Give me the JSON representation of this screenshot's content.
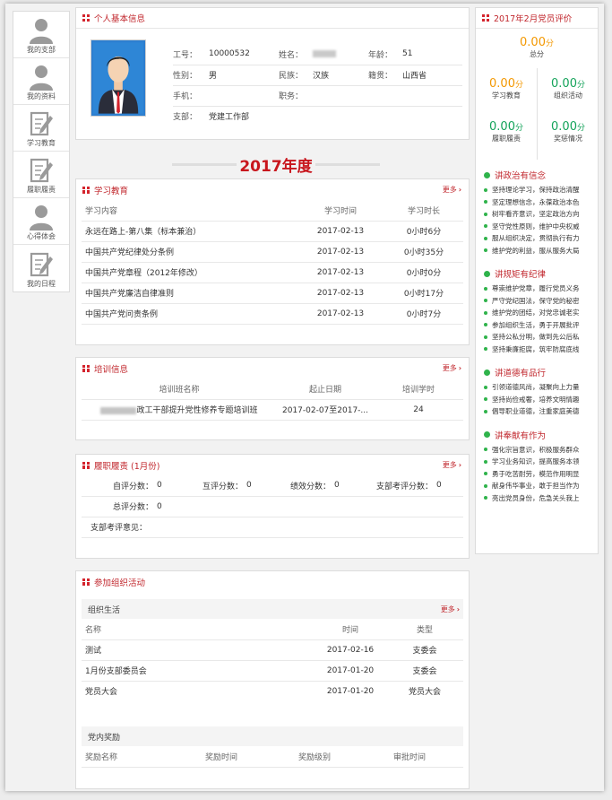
{
  "sidebar": {
    "items": [
      {
        "label": "我的支部",
        "icon": "user-icon"
      },
      {
        "label": "我的资料",
        "icon": "user-icon"
      },
      {
        "label": "学习教育",
        "icon": "pencil-doc-icon"
      },
      {
        "label": "履职履责",
        "icon": "pencil-doc-icon"
      },
      {
        "label": "心得体会",
        "icon": "user-icon"
      },
      {
        "label": "我的日程",
        "icon": "pencil-doc-icon"
      }
    ]
  },
  "profile": {
    "title": "个人基本信息",
    "id_label": "工号：",
    "id_value": "10000532",
    "name_label": "姓名：",
    "age_label": "年龄：",
    "age_value": "51",
    "gender_label": "性别：",
    "gender_value": "男",
    "ethnicity_label": "民族：",
    "ethnicity_value": "汉族",
    "origin_label": "籍贯：",
    "origin_value": "山西省",
    "phone_label": "手机：",
    "position_label": "职务：",
    "branch_label": "支部：",
    "branch_value": "党建工作部"
  },
  "year_banner": "2017年度",
  "study": {
    "title": "学习教育",
    "more": "更多",
    "headers": [
      "学习内容",
      "学习时间",
      "学习时长"
    ],
    "rows": [
      {
        "content": "永远在路上-第八集（标本兼治）",
        "date": "2017-02-13",
        "duration": "0小时6分"
      },
      {
        "content": "中国共产党纪律处分条例",
        "date": "2017-02-13",
        "duration": "0小时35分"
      },
      {
        "content": "中国共产党章程（2012年修改）",
        "date": "2017-02-13",
        "duration": "0小时0分"
      },
      {
        "content": "中国共产党廉洁自律准则",
        "date": "2017-02-13",
        "duration": "0小时17分"
      },
      {
        "content": "中国共产党问责条例",
        "date": "2017-02-13",
        "duration": "0小时7分"
      }
    ]
  },
  "training": {
    "title": "培训信息",
    "more": "更多",
    "headers": [
      "培训班名称",
      "起止日期",
      "培训学时"
    ],
    "row": {
      "name": "政工干部提升党性修养专题培训班",
      "dates": "2017-02-07至2017-...",
      "hours": "24"
    }
  },
  "duty": {
    "title": "履职履责 (1月份)",
    "more": "更多",
    "self_label": "自评分数：",
    "self_value": "0",
    "peer_label": "互评分数：",
    "peer_value": "0",
    "perf_label": "绩效分数：",
    "perf_value": "0",
    "branch_label": "支部考评分数：",
    "branch_value": "0",
    "total_label": "总评分数：",
    "total_value": "0",
    "comment_label": "支部考评意见："
  },
  "activities": {
    "title": "参加组织活动",
    "org_life": "组织生活",
    "more": "更多",
    "headers": [
      "名称",
      "时间",
      "类型"
    ],
    "rows": [
      {
        "name": "测试",
        "date": "2017-02-16",
        "type": "支委会"
      },
      {
        "name": "1月份支部委员会",
        "date": "2017-01-20",
        "type": "支委会"
      },
      {
        "name": "党员大会",
        "date": "2017-01-20",
        "type": "党员大会"
      }
    ],
    "awards_title": "党内奖励",
    "award_headers": [
      "奖励名称",
      "奖励时间",
      "奖励级别",
      "审批时间"
    ]
  },
  "evaluation": {
    "title": "2017年2月党员评价",
    "total_score": "0.00",
    "unit": "分",
    "total_label": "总分",
    "items": [
      {
        "score": "0.00",
        "label": "学习教育"
      },
      {
        "score": "0.00",
        "label": "组织活动"
      },
      {
        "score": "0.00",
        "label": "履职履责"
      },
      {
        "score": "0.00",
        "label": "奖惩情况"
      }
    ],
    "sections": [
      {
        "title": "讲政治有信念",
        "items": [
          "坚持理论学习，保持政治清醒",
          "坚定理想信念，永葆政治本色",
          "树牢看齐意识，坚定政治方向",
          "坚守党性原则，维护中央权威",
          "服从组织决定，贯彻执行有力",
          "维护党的利益，服从服务大局"
        ]
      },
      {
        "title": "讲规矩有纪律",
        "items": [
          "尊崇维护党章，履行党员义务",
          "严守党纪国法，保守党的秘密",
          "维护党的团结，对党忠诚老实",
          "参加组织生活，勇于开展批评",
          "坚持公私分明，做到先公后私",
          "坚持秉廉拒腐，筑牢防腐底线"
        ]
      },
      {
        "title": "讲道德有品行",
        "items": [
          "引领道德风尚，凝聚向上力量",
          "坚持尚俭戒奢，培养文明情趣",
          "倡导职业道德，注重家庭美德"
        ]
      },
      {
        "title": "讲奉献有作为",
        "items": [
          "强化宗旨意识，积极服务群众",
          "学习业务知识，提高服务本领",
          "勇于吃苦耐劳，模范作用明显",
          "献身伟华事业，敢于担当作为",
          "亮出党员身份，危急关头我上"
        ]
      }
    ]
  },
  "colors": {
    "accent": "#c1272d",
    "score_orange": "#f39800",
    "score_green": "#14a35a",
    "bullet_green": "#2fb34b"
  }
}
